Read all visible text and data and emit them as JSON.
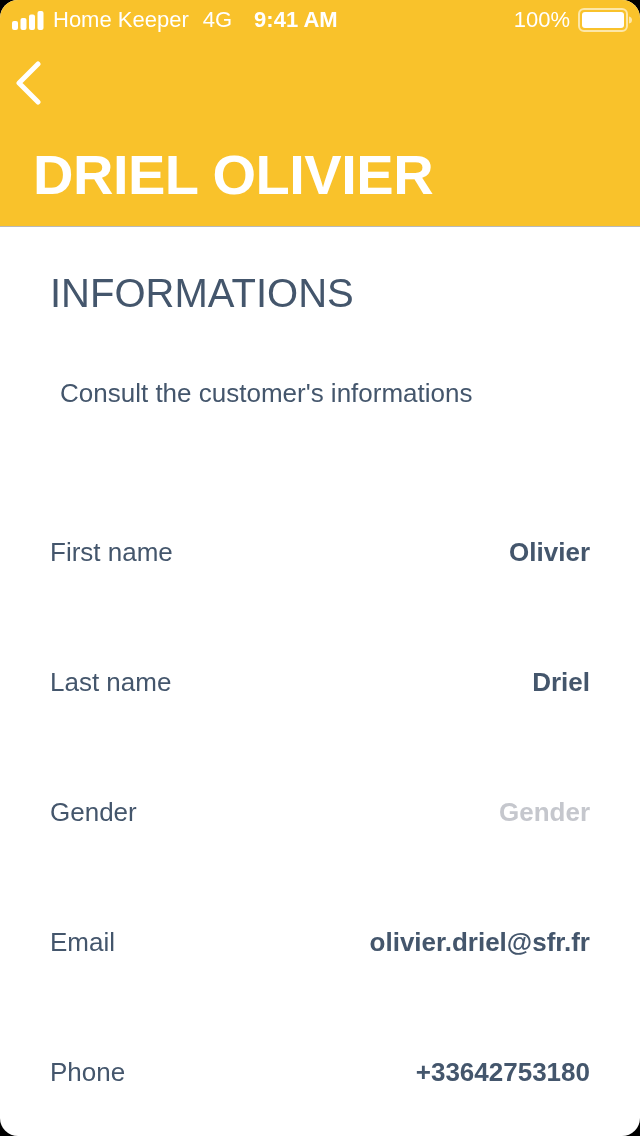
{
  "status_bar": {
    "carrier": "Home Keeper",
    "network": "4G",
    "time": "9:41 AM",
    "battery": "100%"
  },
  "nav": {
    "title": "DRIEL OLIVIER"
  },
  "section": {
    "heading": "INFORMATIONS",
    "description": "Consult the customer's informations"
  },
  "fields": [
    {
      "label": "First name",
      "value": "Olivier"
    },
    {
      "label": "Last name",
      "value": "Driel"
    },
    {
      "label": "Gender",
      "placeholder": "Gender"
    },
    {
      "label": "Email",
      "value": "olivier.driel@sfr.fr"
    },
    {
      "label": "Phone",
      "value": "+33642753180"
    }
  ]
}
